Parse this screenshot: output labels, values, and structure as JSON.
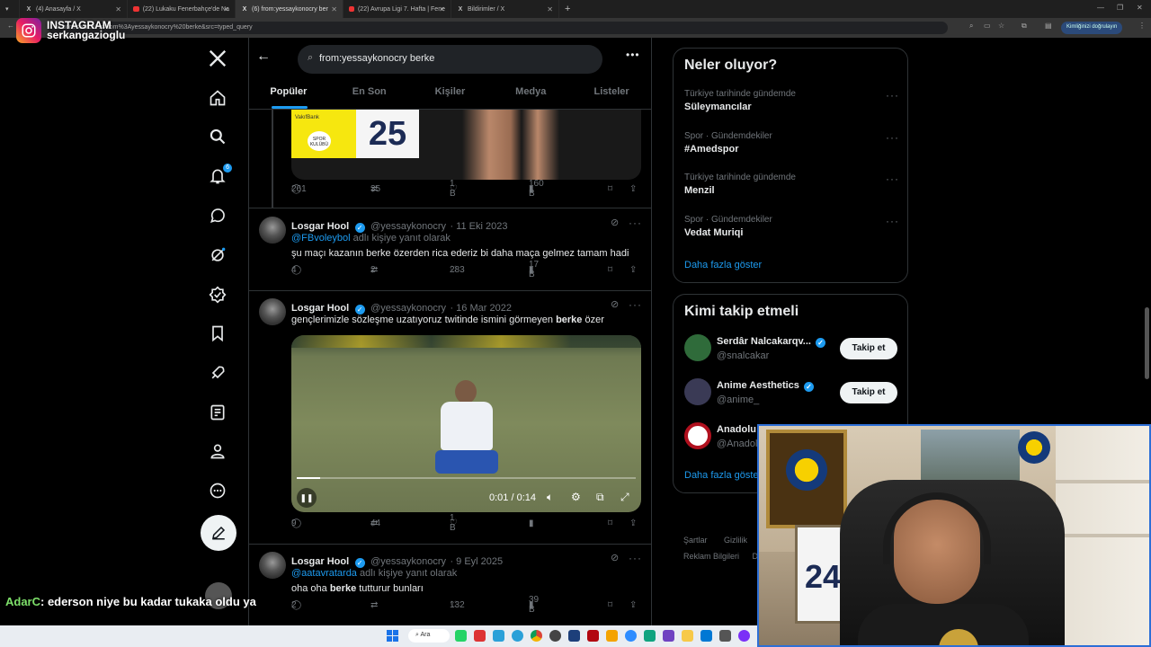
{
  "browser": {
    "tabs": [
      {
        "label": "(4) Anasayfa / X",
        "active": false
      },
      {
        "label": "(22) Lukaku Fenerbahçe'de Na",
        "active": false
      },
      {
        "label": "(6) from:yessaykonocry ber",
        "active": true
      },
      {
        "label": "(22) Avrupa Ligi 7. Hafta | Fene",
        "active": false
      },
      {
        "label": "Bildirimler / X",
        "active": false
      }
    ],
    "url": "x.com/search?q=from%3Ayessaykonocry%20berke&src=typed_query",
    "identity_pill": "Kimliğinizi doğrulayın"
  },
  "overlay": {
    "instagram_label": "INSTAGRAM",
    "instagram_user": "serkangazioglu",
    "chat_user": "AdarC",
    "chat_message": ": ederson niye bu kadar tukaka oldu ya"
  },
  "nav": {
    "notifications_badge": "6"
  },
  "search": {
    "query": "from:yessaykonocry berke"
  },
  "tabs": [
    "Popüler",
    "En Son",
    "Kişiler",
    "Medya",
    "Listeler"
  ],
  "top_tweet": {
    "replies": "261",
    "reposts": "35",
    "likes": "1 B",
    "views": "160 B",
    "image_text": "25",
    "image_sponsor": "VakıfBank",
    "image_badge": "SPOR KULÜBÜ"
  },
  "tweets": [
    {
      "name": "Losgar Hool",
      "handle": "@yessaykonocry",
      "date": "· 11 Eki 2023",
      "reply_to": "@FBvoleybol",
      "reply_suffix": "adlı kişiye yanıt olarak",
      "text": "şu maçı kazanın berke özerden rica ederiz bi daha maça gelmez tamam hadi",
      "replies": "4",
      "reposts": "2",
      "likes": "283",
      "views": "17 B"
    },
    {
      "name": "Losgar Hool",
      "handle": "@yessaykonocry",
      "date": "· 16 Mar 2022",
      "text_before": "gençlerimizle sözleşme uzatıyoruz twitinde ismini görmeyen ",
      "text_bold": "berke",
      "text_after": " özer",
      "video_time": "0:01 / 0:14",
      "video_progress": 0.07,
      "replies": "9",
      "reposts": "44",
      "likes": "1 B"
    },
    {
      "name": "Losgar Hool",
      "handle": "@yessaykonocry",
      "date": "· 9 Eyl 2025",
      "reply_to": "@aatavratarda",
      "reply_suffix": "adlı kişiye yanıt olarak",
      "text_before": "oha oha ",
      "text_bold": "berke",
      "text_after": " tutturur bunları",
      "replies": "2",
      "likes": "132",
      "views": "39 B"
    }
  ],
  "trends": {
    "title": "Neler oluyor?",
    "items": [
      {
        "context": "Türkiye tarihinde gündemde",
        "name": "Süleymancılar"
      },
      {
        "context": "Spor · Gündemdekiler",
        "name": "#Amedspor"
      },
      {
        "context": "Türkiye tarihinde gündemde",
        "name": "Menzil"
      },
      {
        "context": "Spor · Gündemdekiler",
        "name": "Vedat Muriqi"
      }
    ],
    "show_more": "Daha fazla göster"
  },
  "who_to_follow": {
    "title": "Kimi takip etmeli",
    "items": [
      {
        "name": "Serdâr Nalcakarqv...",
        "handle": "@snalcakar",
        "button": "Takip et"
      },
      {
        "name": "Anime Aesthetics",
        "handle": "@anime_",
        "button": "Takip et"
      },
      {
        "name": "Anadolu",
        "handle": "@Anadol"
      }
    ],
    "show_more": "Daha fazla göste"
  },
  "footer": {
    "links": [
      "Şartlar",
      "Gizlilik",
      "Reklam Bilgileri",
      "D"
    ]
  },
  "taskbar": {
    "search_label": "Ara"
  },
  "webcam": {
    "jersey_number": "24"
  },
  "colors": {
    "accent": "#1d9bf0",
    "background": "#000000",
    "border": "#2f3336",
    "muted": "#71767b",
    "webcam_border": "#2d6fd6"
  }
}
